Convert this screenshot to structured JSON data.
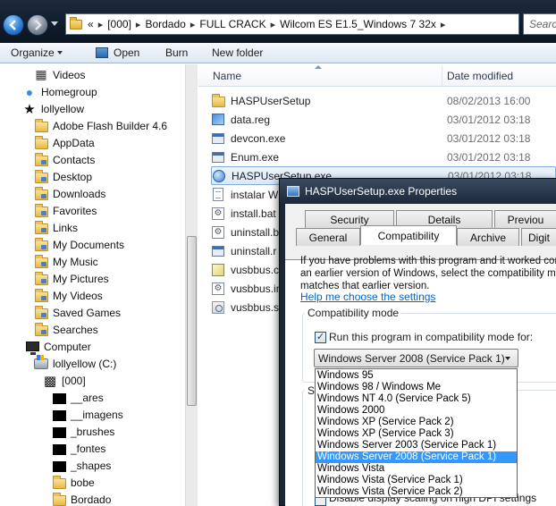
{
  "address": {
    "crumbs": [
      "[000]",
      "Bordado",
      "FULL CRACK",
      "Wilcom ES E1.5_Windows 7 32x"
    ],
    "overflow": "«",
    "search_placeholder": "Search"
  },
  "toolbar": {
    "organize": "Organize",
    "open": "Open",
    "burn": "Burn",
    "new_folder": "New folder"
  },
  "nav": {
    "items": [
      {
        "label": "Videos",
        "icon": "video-folder-icon"
      },
      {
        "label": "Homegroup",
        "icon": "homegroup-icon"
      },
      {
        "label": "lollyellow",
        "icon": "user-star-icon"
      },
      {
        "label": "Adobe Flash Builder 4.6",
        "icon": "folder-icon"
      },
      {
        "label": "AppData",
        "icon": "folder-icon"
      },
      {
        "label": "Contacts",
        "icon": "folder-icon"
      },
      {
        "label": "Desktop",
        "icon": "folder-icon"
      },
      {
        "label": "Downloads",
        "icon": "folder-icon"
      },
      {
        "label": "Favorites",
        "icon": "folder-icon"
      },
      {
        "label": "Links",
        "icon": "folder-icon"
      },
      {
        "label": "My Documents",
        "icon": "folder-icon"
      },
      {
        "label": "My Music",
        "icon": "folder-icon"
      },
      {
        "label": "My Pictures",
        "icon": "folder-icon"
      },
      {
        "label": "My Videos",
        "icon": "folder-icon"
      },
      {
        "label": "Saved Games",
        "icon": "folder-icon"
      },
      {
        "label": "Searches",
        "icon": "folder-icon"
      },
      {
        "label": "Computer",
        "icon": "computer-icon"
      },
      {
        "label": "lollyellow (C:)",
        "icon": "drive-icon"
      },
      {
        "label": "[000]",
        "icon": "pattern-folder-icon"
      },
      {
        "label": "__ares",
        "icon": "black-folder-icon"
      },
      {
        "label": "__imagens",
        "icon": "black-folder-icon"
      },
      {
        "label": "_brushes",
        "icon": "black-folder-icon"
      },
      {
        "label": "_fontes",
        "icon": "black-folder-icon"
      },
      {
        "label": "_shapes",
        "icon": "black-folder-icon"
      },
      {
        "label": "bobe",
        "icon": "folder-icon"
      },
      {
        "label": "Bordado",
        "icon": "folder-icon"
      }
    ]
  },
  "columns": {
    "name": "Name",
    "date": "Date modified"
  },
  "files": [
    {
      "name": "HASPUserSetup",
      "date": "08/02/2013 16:00",
      "icon": "folder-icon"
    },
    {
      "name": "data.reg",
      "date": "03/01/2012 03:18",
      "icon": "registry-icon"
    },
    {
      "name": "devcon.exe",
      "date": "03/01/2012 03:18",
      "icon": "exe-icon"
    },
    {
      "name": "Enum.exe",
      "date": "03/01/2012 03:18",
      "icon": "exe-icon"
    },
    {
      "name": "HASPUserSetup.exe",
      "date": "03/01/2012 03:18",
      "icon": "setup-icon"
    },
    {
      "name": "instalar W",
      "date": "",
      "icon": "doc-icon"
    },
    {
      "name": "install.bat",
      "date": "",
      "icon": "batch-icon"
    },
    {
      "name": "uninstall.b",
      "date": "",
      "icon": "batch-icon"
    },
    {
      "name": "uninstall.r",
      "date": "",
      "icon": "exe-icon"
    },
    {
      "name": "vusbbus.c",
      "date": "",
      "icon": "pencil-icon"
    },
    {
      "name": "vusbbus.in",
      "date": "",
      "icon": "settings-file-icon"
    },
    {
      "name": "vusbbus.sy",
      "date": "",
      "icon": "system-file-icon"
    }
  ],
  "dialog": {
    "title": "HASPUserSetup.exe Properties",
    "tabs_row1": [
      "Security",
      "Details",
      "Previou"
    ],
    "tabs_row2": [
      "General",
      "Compatibility",
      "Archive",
      "Digit"
    ],
    "desc_lines": [
      "If you have problems with this program and it worked correctl",
      "an earlier version of Windows, select the compatibility mode t",
      "matches that earlier version."
    ],
    "help_link": "Help me choose the settings",
    "compat_group": "Compatibility mode",
    "compat_check_label": "Run this program in compatibility mode for:",
    "compat_check_mark": "✓",
    "selected_value": "Windows Server 2008 (Service Pack 1)",
    "settings_group": "S",
    "hidden_text": "Disable display scaling on high DPI settings",
    "options": [
      "Windows 95",
      "Windows 98 / Windows Me",
      "Windows NT 4.0 (Service Pack 5)",
      "Windows 2000",
      "Windows XP (Service Pack 2)",
      "Windows XP (Service Pack 3)",
      "Windows Server 2003 (Service Pack 1)",
      "Windows Server 2008 (Service Pack 1)",
      "Windows Vista",
      "Windows Vista (Service Pack 1)",
      "Windows Vista (Service Pack 2)"
    ],
    "selected_index": 7
  },
  "colors": {
    "selection": "#3399ff",
    "link": "#0066cc",
    "title_bar": "#1d2a3c"
  }
}
